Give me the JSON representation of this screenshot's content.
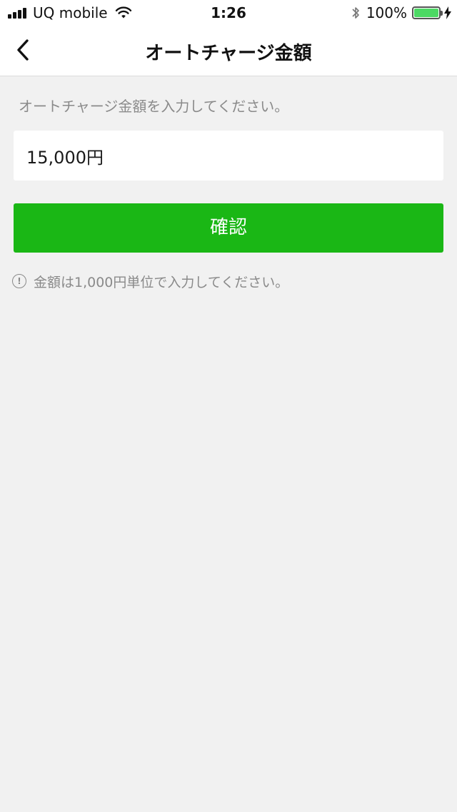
{
  "status_bar": {
    "carrier": "UQ mobile",
    "time": "1:26",
    "battery_percent": "100%",
    "battery_level": 1.0,
    "icons": [
      "signal-icon",
      "wifi-icon",
      "bluetooth-icon",
      "battery-icon",
      "charging-bolt-icon"
    ]
  },
  "nav": {
    "title": "オートチャージ金額",
    "back_icon": "chevron-left-icon"
  },
  "form": {
    "instruction": "オートチャージ金額を入力してください。",
    "amount_value": "15,000円",
    "confirm_label": "確認"
  },
  "notice": {
    "icon": "info-exclamation-icon",
    "text": "金額は1,000円単位で入力してください。"
  },
  "colors": {
    "accent_green": "#1ab715",
    "background": "#f1f1f1",
    "battery_green": "#4cd964"
  }
}
